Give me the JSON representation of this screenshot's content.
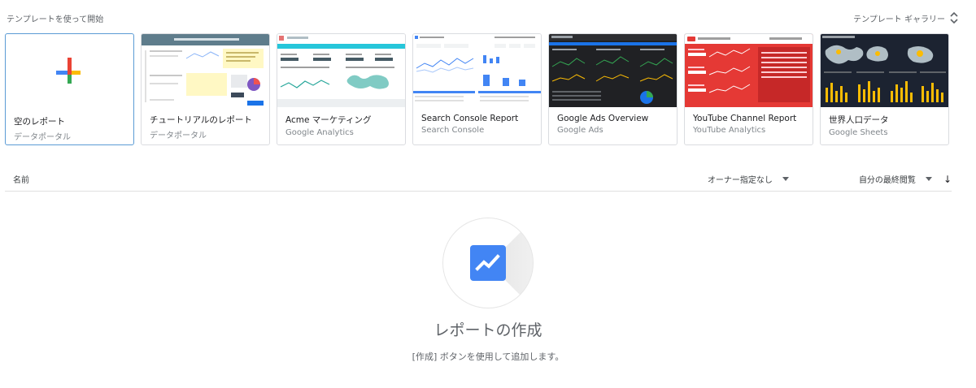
{
  "header": {
    "title": "テンプレートを使って開始",
    "gallery_label": "テンプレート ギャラリー"
  },
  "templates": [
    {
      "title": "空のレポート",
      "subtitle": "データポータル"
    },
    {
      "title": "チュートリアルのレポート",
      "subtitle": "データポータル"
    },
    {
      "title": "Acme マーケティング",
      "subtitle": "Google Analytics"
    },
    {
      "title": "Search Console Report",
      "subtitle": "Search Console"
    },
    {
      "title": "Google Ads Overview",
      "subtitle": "Google Ads"
    },
    {
      "title": "YouTube Channel Report",
      "subtitle": "YouTube Analytics"
    },
    {
      "title": "世界人口データ",
      "subtitle": "Google Sheets"
    }
  ],
  "list": {
    "name_header": "名前",
    "owner_filter": "オーナー指定なし",
    "sort_label": "自分の最終閲覧",
    "sort_arrow": "↓"
  },
  "empty_state": {
    "title": "レポートの作成",
    "description": "[作成] ボタンを使用して追加します。"
  },
  "colors": {
    "accent_blue": "#4285f4",
    "plus_red": "#ea4335",
    "plus_yellow": "#fbbc04",
    "plus_green": "#34a853"
  }
}
